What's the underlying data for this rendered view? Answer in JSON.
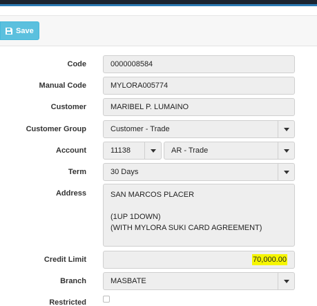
{
  "toolbar": {
    "save_label": "Save",
    "save_icon": "floppy-disk-icon"
  },
  "form": {
    "code": {
      "label": "Code",
      "value": "0000008584"
    },
    "manual_code": {
      "label": "Manual Code",
      "value": "MYLORA005774"
    },
    "customer": {
      "label": "Customer",
      "value": "MARIBEL P. LUMAINO"
    },
    "customer_group": {
      "label": "Customer Group",
      "value": "Customer - Trade"
    },
    "account": {
      "label": "Account",
      "code_value": "11138",
      "name_value": "AR - Trade"
    },
    "term": {
      "label": "Term",
      "value": "30 Days"
    },
    "address": {
      "label": "Address",
      "value": "SAN MARCOS PLACER\n\n(1UP 1DOWN)\n(WITH MYLORA SUKI CARD AGREEMENT)"
    },
    "credit_limit": {
      "label": "Credit Limit",
      "value": "70,000.00"
    },
    "branch": {
      "label": "Branch",
      "value": "MASBATE"
    },
    "restricted": {
      "label": "Restricted",
      "checked": false
    }
  },
  "colors": {
    "save_button": "#5bc0de",
    "highlight": "#f6f600"
  }
}
